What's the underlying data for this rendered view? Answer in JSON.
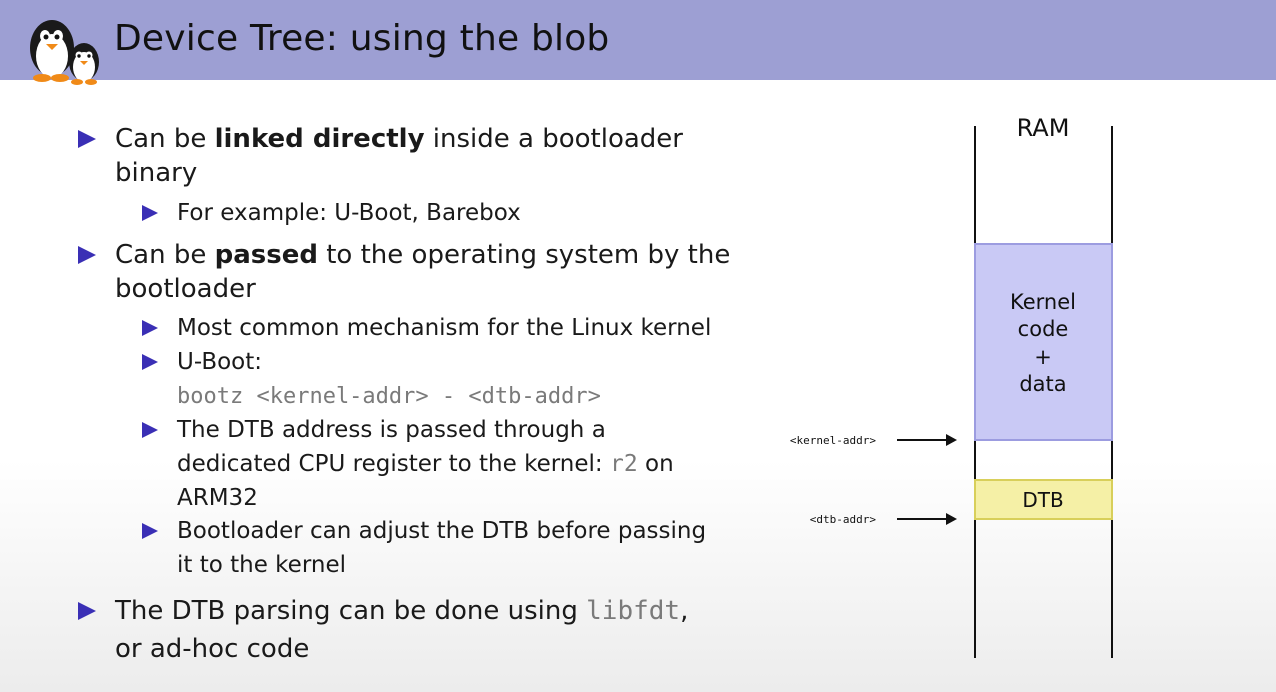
{
  "header": {
    "title": "Device Tree: using the blob"
  },
  "bullets": {
    "b1": {
      "pre": "Can be ",
      "bold": "linked directly",
      "post": " inside a bootloader",
      "cont": "binary"
    },
    "b1_1": {
      "text": "For example: U-Boot, Barebox"
    },
    "b2": {
      "pre": "Can be ",
      "bold": "passed",
      "post": " to the operating system by the",
      "cont": "bootloader"
    },
    "b2_1": {
      "text": "Most common mechanism for the Linux kernel"
    },
    "b2_2": {
      "text": "U-Boot:",
      "code": "bootz <kernel-addr> - <dtb-addr>"
    },
    "b2_3": {
      "line1": "The DTB address is passed through a",
      "line2_pre": "dedicated CPU register to the kernel: ",
      "line2_code": "r2",
      "line2_post": " on",
      "line3": "ARM32"
    },
    "b2_4": {
      "line1": "Bootloader can adjust the DTB before passing",
      "line2": "it to the kernel"
    },
    "b3": {
      "pre": "The DTB parsing can be done using ",
      "code": "libfdt",
      "post": ",",
      "cont": "or ad-hoc code"
    }
  },
  "diagram": {
    "ram_label": "RAM",
    "kernel_block": [
      "Kernel",
      "code",
      "+",
      "data"
    ],
    "dtb_block": "DTB",
    "kernel_addr_label": "<kernel-addr>",
    "dtb_addr_label": "<dtb-addr>",
    "colors": {
      "kernel_fill": "#c9c9f5",
      "kernel_border": "#9c9ce0",
      "dtb_fill": "#f5f0a6",
      "dtb_border": "#d8cf5a"
    }
  },
  "colors": {
    "title_bar": "#9d9fd3",
    "bullet": "#3a2fb5"
  }
}
